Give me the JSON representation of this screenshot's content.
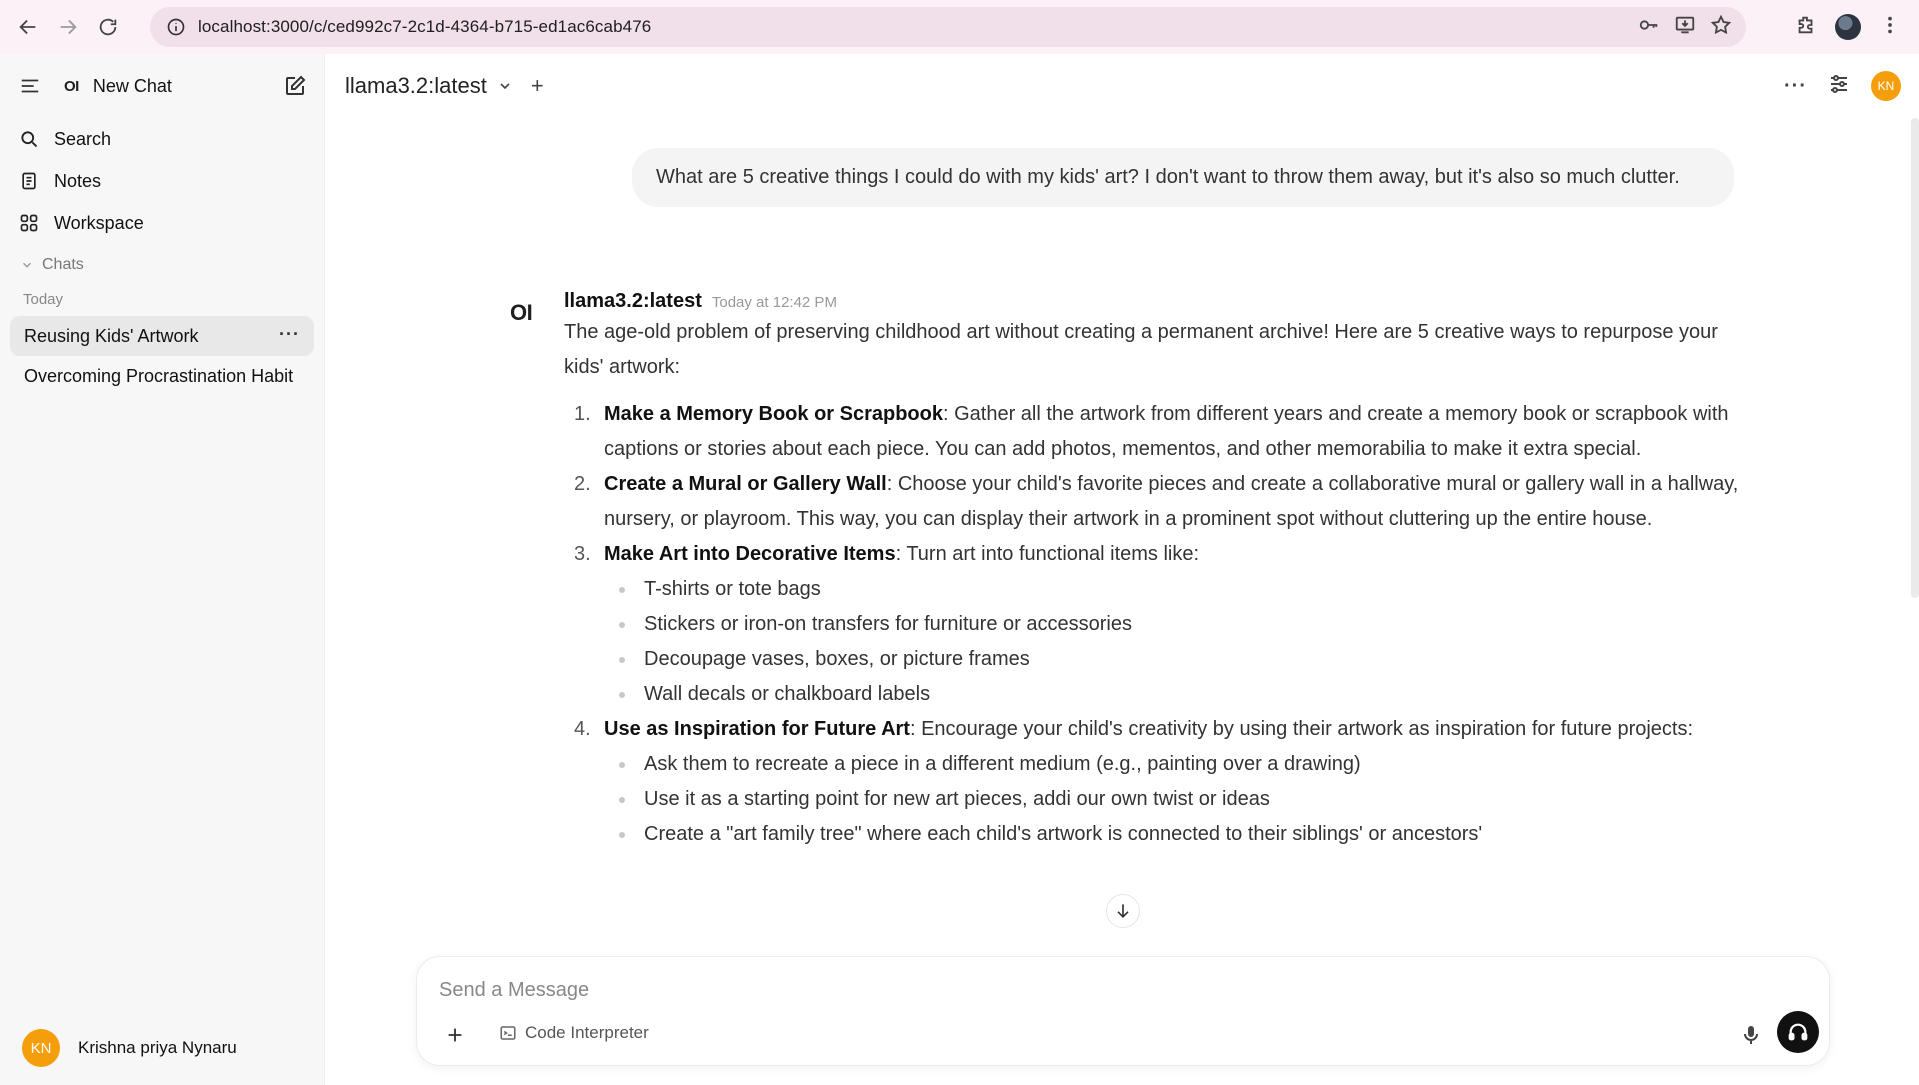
{
  "browser": {
    "url": "localhost:3000/c/ced992c7-2c1d-4364-b715-ed1ac6cab476"
  },
  "sidebar": {
    "logo": "OI",
    "new_chat": "New Chat",
    "items": [
      {
        "label": "Search",
        "icon": "search-icon"
      },
      {
        "label": "Notes",
        "icon": "notes-icon"
      },
      {
        "label": "Workspace",
        "icon": "workspace-icon"
      }
    ],
    "section": "Chats",
    "group": "Today",
    "chats": [
      {
        "title": "Reusing Kids' Artwork",
        "active": true
      },
      {
        "title": "Overcoming Procrastination Habit",
        "active": false
      }
    ],
    "user": {
      "initials": "KN",
      "name": "Krishna priya Nynaru"
    }
  },
  "header": {
    "model": "llama3.2:latest",
    "add": "+",
    "more": "···",
    "avatar_initials": "KN"
  },
  "conversation": {
    "user_message": "What are 5 creative things I could do with my kids' art? I don't want to throw them away, but it's also so much clutter.",
    "assistant": {
      "logo": "OI",
      "name": "llama3.2:latest",
      "time": "Today at 12:42 PM",
      "intro": "The age-old problem of preserving childhood art without creating a permanent archive! Here are 5 creative ways to repurpose your kids' artwork:",
      "items": [
        {
          "num": "1.",
          "title": "Make a Memory Book or Scrapbook",
          "text": ": Gather all the artwork from different years and create a memory book or scrapbook with captions or stories about each piece. You can add photos, mementos, and other memorabilia to make it extra special."
        },
        {
          "num": "2.",
          "title": "Create a Mural or Gallery Wall",
          "text": ": Choose your child's favorite pieces and create a collaborative mural or gallery wall in a hallway, nursery, or playroom. This way, you can display their artwork in a prominent spot without cluttering up the entire house."
        },
        {
          "num": "3.",
          "title": "Make Art into Decorative Items",
          "text": ": Turn art into functional items like:",
          "bullets": [
            "T-shirts or tote bags",
            "Stickers or iron-on transfers for furniture or accessories",
            "Decoupage vases, boxes, or picture frames",
            "Wall decals or chalkboard labels"
          ]
        },
        {
          "num": "4.",
          "title": "Use as Inspiration for Future Art",
          "text": ": Encourage your child's creativity by using their artwork as inspiration for future projects:",
          "bullets": [
            "Ask them to recreate a piece in a different medium (e.g., painting over a drawing)",
            "Use it as a starting point for new art pieces, addi    our own twist or ideas",
            "Create a \"art family tree\" where each child's artwork is connected to their siblings' or ancestors'"
          ]
        }
      ]
    }
  },
  "composer": {
    "placeholder": "Send a Message",
    "tool": "Code Interpreter"
  },
  "colors": {
    "accent_avatar": "#f59e0b",
    "sidebar_bg": "#f7f7f7",
    "bubble_bg": "#f4f4f4",
    "browser_bar": "#fbf1f6",
    "url_bar": "#f1dfe9"
  }
}
